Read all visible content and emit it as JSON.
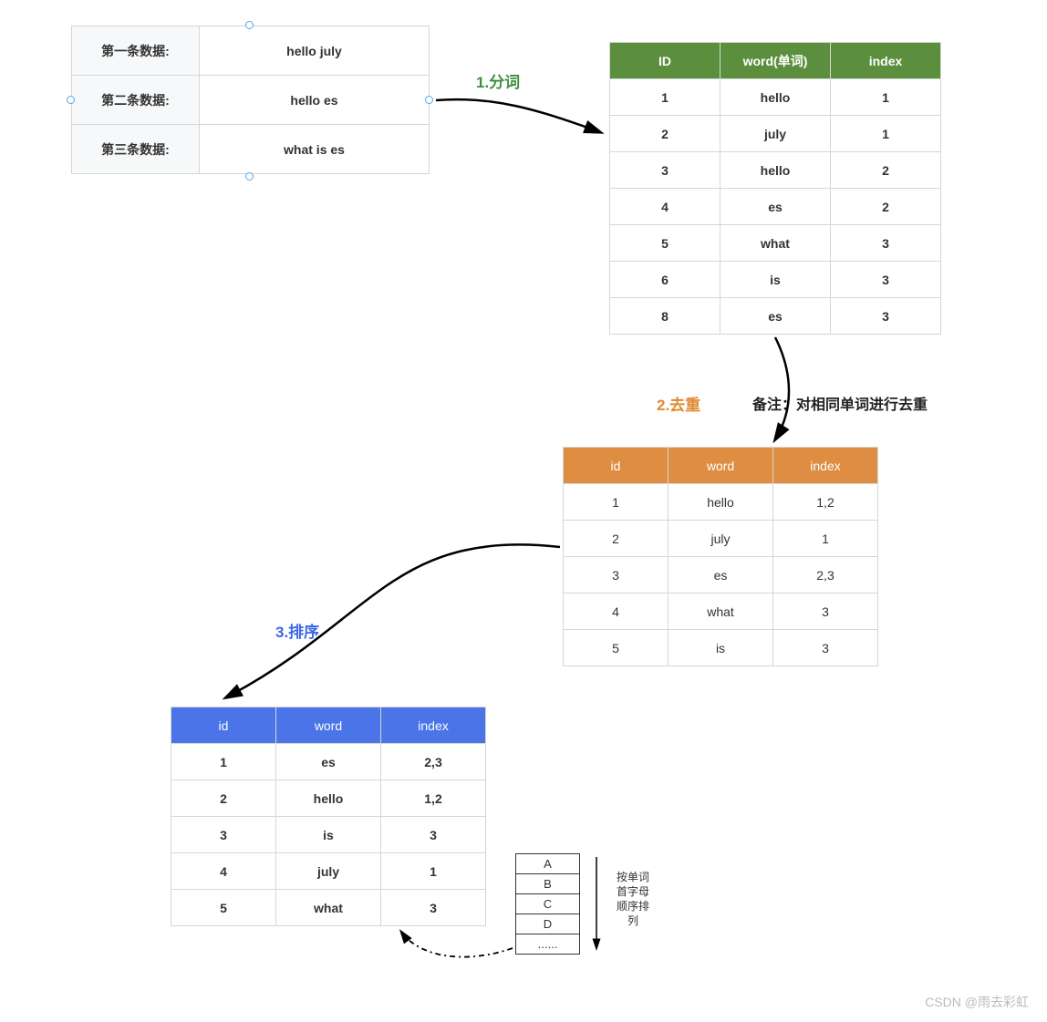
{
  "source": {
    "rows": [
      {
        "label": "第一条数据:",
        "value": "hello july"
      },
      {
        "label": "第二条数据:",
        "value": "hello es"
      },
      {
        "label": "第三条数据:",
        "value": "what is es"
      }
    ]
  },
  "steps": {
    "step1": "1.分词",
    "step2": "2.去重",
    "step3": "3.排序"
  },
  "note_dedup": "备注：对相同单词进行去重",
  "tokenized": {
    "headers": [
      "ID",
      "word(单词)",
      "index"
    ],
    "rows": [
      {
        "id": "1",
        "word": "hello",
        "index": "1"
      },
      {
        "id": "2",
        "word": "july",
        "index": "1"
      },
      {
        "id": "3",
        "word": "hello",
        "index": "2"
      },
      {
        "id": "4",
        "word": "es",
        "index": "2"
      },
      {
        "id": "5",
        "word": "what",
        "index": "3"
      },
      {
        "id": "6",
        "word": "is",
        "index": "3"
      },
      {
        "id": "8",
        "word": "es",
        "index": "3"
      }
    ]
  },
  "dedup": {
    "headers": [
      "id",
      "word",
      "index"
    ],
    "rows": [
      {
        "id": "1",
        "word": "hello",
        "index": "1,2"
      },
      {
        "id": "2",
        "word": "july",
        "index": "1"
      },
      {
        "id": "3",
        "word": "es",
        "index": "2,3"
      },
      {
        "id": "4",
        "word": "what",
        "index": "3"
      },
      {
        "id": "5",
        "word": "is",
        "index": "3"
      }
    ]
  },
  "sorted": {
    "headers": [
      "id",
      "word",
      "index"
    ],
    "rows": [
      {
        "id": "1",
        "word": "es",
        "index": "2,3"
      },
      {
        "id": "2",
        "word": "hello",
        "index": "1,2"
      },
      {
        "id": "3",
        "word": "is",
        "index": "3"
      },
      {
        "id": "4",
        "word": "july",
        "index": "1"
      },
      {
        "id": "5",
        "word": "what",
        "index": "3"
      }
    ]
  },
  "alphabet": [
    "A",
    "B",
    "C",
    "D",
    "......"
  ],
  "alpha_caption": "按单词\n首字母\n顺序排\n列",
  "watermark": "CSDN @雨去彩虹"
}
